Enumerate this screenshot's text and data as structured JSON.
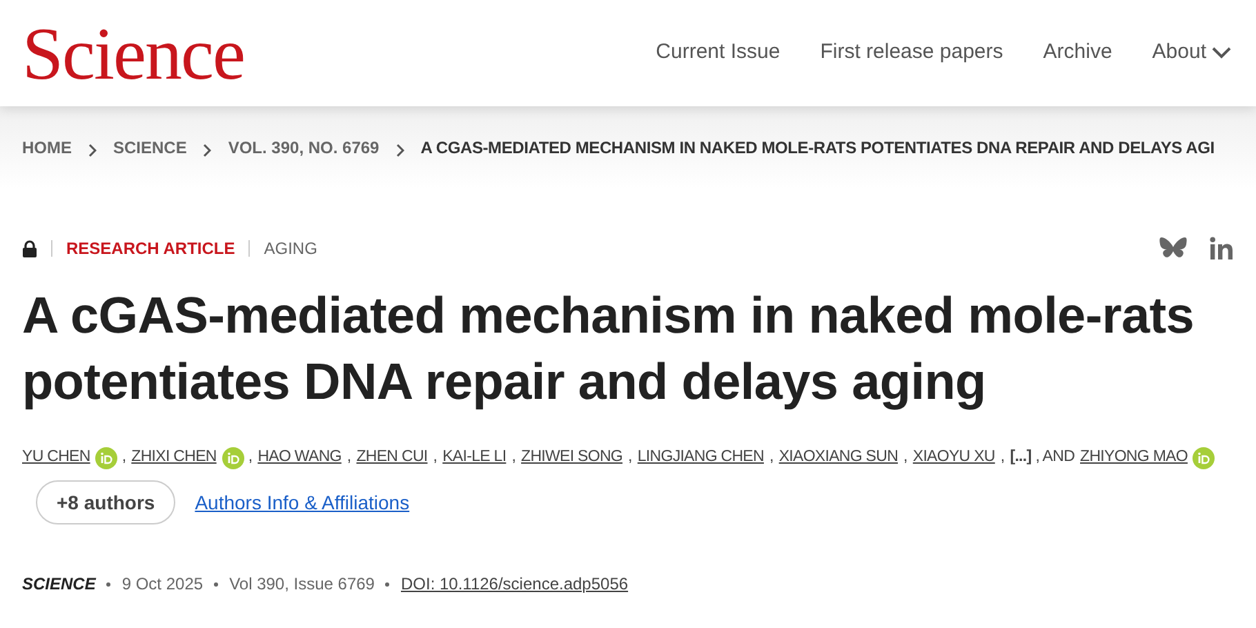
{
  "header": {
    "logo": "Science",
    "nav": [
      {
        "label": "Current Issue",
        "has_menu": false
      },
      {
        "label": "First release papers",
        "has_menu": false
      },
      {
        "label": "Archive",
        "has_menu": false
      },
      {
        "label": "About",
        "has_menu": true
      }
    ]
  },
  "breadcrumb": [
    {
      "label": "HOME",
      "current": false
    },
    {
      "label": "SCIENCE",
      "current": false
    },
    {
      "label": "VOL. 390, NO. 6769",
      "current": false
    },
    {
      "label": "A CGAS-MEDIATED MECHANISM IN NAKED MOLE-RATS POTENTIATES DNA REPAIR AND DELAYS AGI",
      "current": true
    }
  ],
  "article": {
    "locked": true,
    "type": "RESEARCH ARTICLE",
    "topic": "AGING",
    "title": "A cGAS-mediated mechanism in naked mole-rats potentiates DNA repair and delays aging",
    "author_line": [
      {
        "kind": "author",
        "text": "YU CHEN",
        "orcid": true
      },
      {
        "kind": "separator",
        "text": ","
      },
      {
        "kind": "author",
        "text": "ZHIXI CHEN",
        "orcid": true
      },
      {
        "kind": "separator",
        "text": ","
      },
      {
        "kind": "author",
        "text": "HAO WANG",
        "orcid": false
      },
      {
        "kind": "separator",
        "text": ","
      },
      {
        "kind": "author",
        "text": "ZHEN CUI",
        "orcid": false
      },
      {
        "kind": "separator",
        "text": ","
      },
      {
        "kind": "author",
        "text": "KAI-LE LI",
        "orcid": false
      },
      {
        "kind": "separator",
        "text": ","
      },
      {
        "kind": "author",
        "text": "ZHIWEI SONG",
        "orcid": false
      },
      {
        "kind": "separator",
        "text": ","
      },
      {
        "kind": "author",
        "text": "LINGJIANG CHEN",
        "orcid": false
      },
      {
        "kind": "separator",
        "text": ","
      },
      {
        "kind": "author",
        "text": "XIAOXIANG SUN",
        "orcid": false
      },
      {
        "kind": "separator",
        "text": ","
      },
      {
        "kind": "author",
        "text": "XIAOYU XU",
        "orcid": false
      },
      {
        "kind": "separator",
        "text": ","
      },
      {
        "kind": "ellipsis",
        "text": "[...]"
      },
      {
        "kind": "separator",
        "text": ", AND"
      },
      {
        "kind": "author",
        "text": "ZHIYONG MAO",
        "orcid": true
      }
    ],
    "more_authors": "+8 authors",
    "affiliations_link": "Authors Info & Affiliations",
    "meta": [
      {
        "kind": "journal",
        "text": "SCIENCE"
      },
      {
        "kind": "plain",
        "text": "9 Oct 2025"
      },
      {
        "kind": "plain",
        "text": "Vol 390, Issue 6769"
      },
      {
        "kind": "link",
        "text": "DOI: 10.1126/science.adp5056"
      }
    ]
  }
}
